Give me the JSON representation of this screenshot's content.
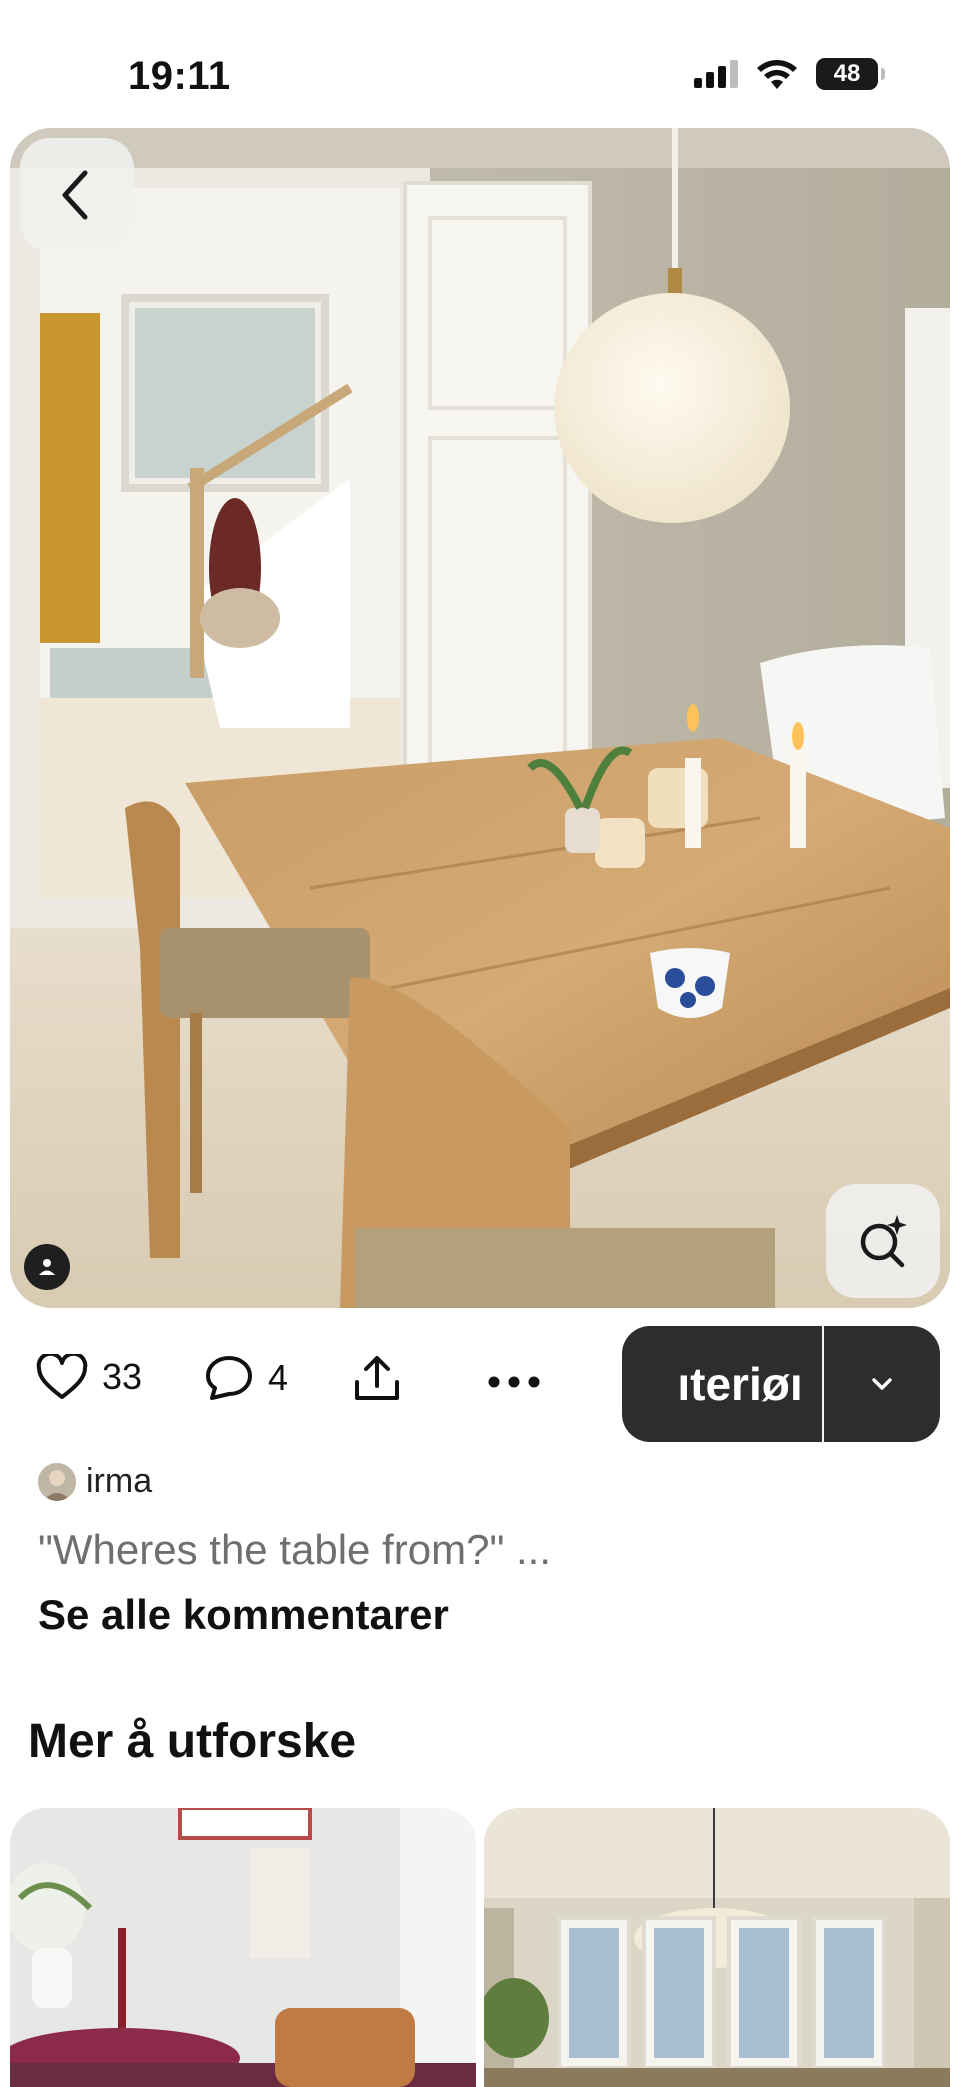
{
  "status_bar": {
    "time": "19:11",
    "battery": "48",
    "icons": [
      "cellular-signal-icon",
      "wifi-icon",
      "battery-icon"
    ]
  },
  "pin": {
    "image_description_icons": [
      "back-arrow-icon",
      "visual-search-icon",
      "user-icon"
    ],
    "like_count": "33",
    "comment_count": "4",
    "board_name": "Interiør",
    "board_visible_text": "ıteriøı"
  },
  "comments": {
    "commenter": "irma",
    "text": "\"Wheres the table from?\" ...",
    "see_all": "Se alle kommentarer"
  },
  "explore": {
    "title": "Mer å utforske"
  },
  "colors": {
    "save_button_bg": "#2d2e2b",
    "comment_grey": "#6f6f6f",
    "text": "#111111"
  }
}
